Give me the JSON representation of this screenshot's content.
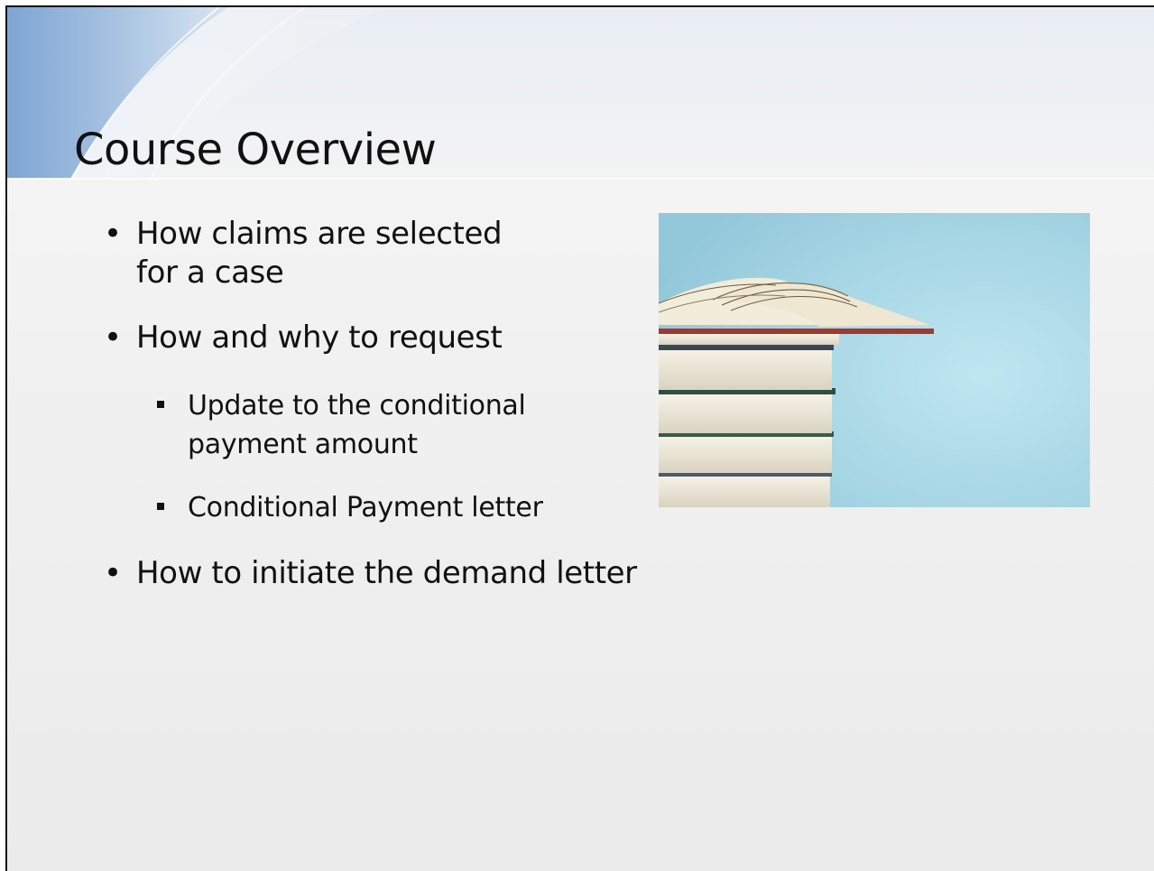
{
  "slide": {
    "title": "Course Overview",
    "bullets": [
      {
        "text": "How claims are selected for a case",
        "line1": "How claims are selected",
        "line2": "for a case"
      },
      {
        "text": "How and why to request"
      },
      {
        "text": "How to initiate the demand letter"
      }
    ],
    "sub_bullets": [
      {
        "line1": "Update to the conditional",
        "line2": "payment amount"
      },
      {
        "line1": "Conditional Payment letter"
      }
    ],
    "bullet_glyph": "•",
    "image_icon": "stack-of-books-photo",
    "colors": {
      "photo_background": "#a9d8e6",
      "swoosh_blue": "#7ea6d6",
      "text": "#111111"
    }
  }
}
